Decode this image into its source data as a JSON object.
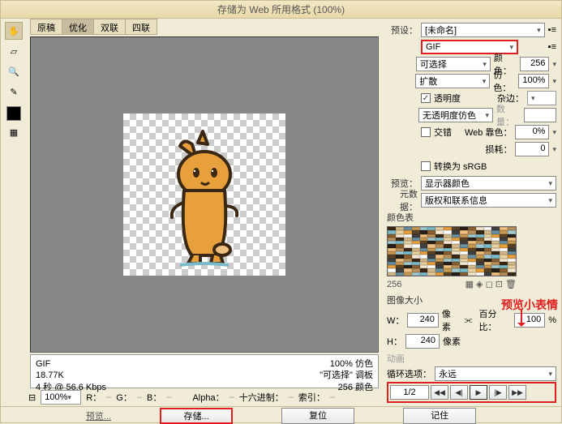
{
  "title": "存储为 Web 所用格式 (100%)",
  "tabs": {
    "t0": "原稿",
    "t1": "优化",
    "t2": "双联",
    "t3": "四联"
  },
  "info": {
    "fmt": "GIF",
    "size": "18.77K",
    "time": "4 秒 @ 56.6 Kbps",
    "qual": "100% 仿色",
    "pal": "\"可选择\" 调板",
    "cols": "256 颜色"
  },
  "status": {
    "hand_zoom": "100%",
    "r": "R：",
    "g": "G：",
    "b": "B：",
    "alpha": "Alpha：",
    "hex": "十六进制：",
    "index": "索引："
  },
  "footer": {
    "preview": "预览...",
    "save": "存储...",
    "reset": "复位",
    "remember": "记住"
  },
  "panel": {
    "preset_lbl": "预设：",
    "preset": "[未命名]",
    "format": "GIF",
    "reduction": "可选择",
    "colors_lbl": "颜色：",
    "colors": "256",
    "dither": "扩散",
    "dither_lbl": "仿色：",
    "dither_v": "100%",
    "transparency": "透明度",
    "matte_lbl": "杂边：",
    "trans_dither": "无透明度仿色",
    "amount_lbl": "数量：",
    "interlace": "交错",
    "web_lbl": "Web 靠色：",
    "web_v": "0%",
    "loss_lbl": "损耗：",
    "loss_v": "0",
    "convert": "转换为 sRGB",
    "preview_lbl": "预览：",
    "preview_v": "显示器颜色",
    "meta_lbl": "元数据：",
    "meta_v": "版权和联系信息",
    "pal_title": "颜色表",
    "pal_count": "256",
    "size_title": "图像大小",
    "w_lbl": "W：",
    "w": "240",
    "px1": "像素",
    "h_lbl": "H：",
    "h": "240",
    "px2": "像素",
    "pct_lbl": "百分比：",
    "pct": "100",
    "pct_u": "%",
    "anim_title": "动画",
    "loop_lbl": "循环选项：",
    "loop": "永远",
    "frames": "1/2",
    "callout": "预览小表情"
  }
}
